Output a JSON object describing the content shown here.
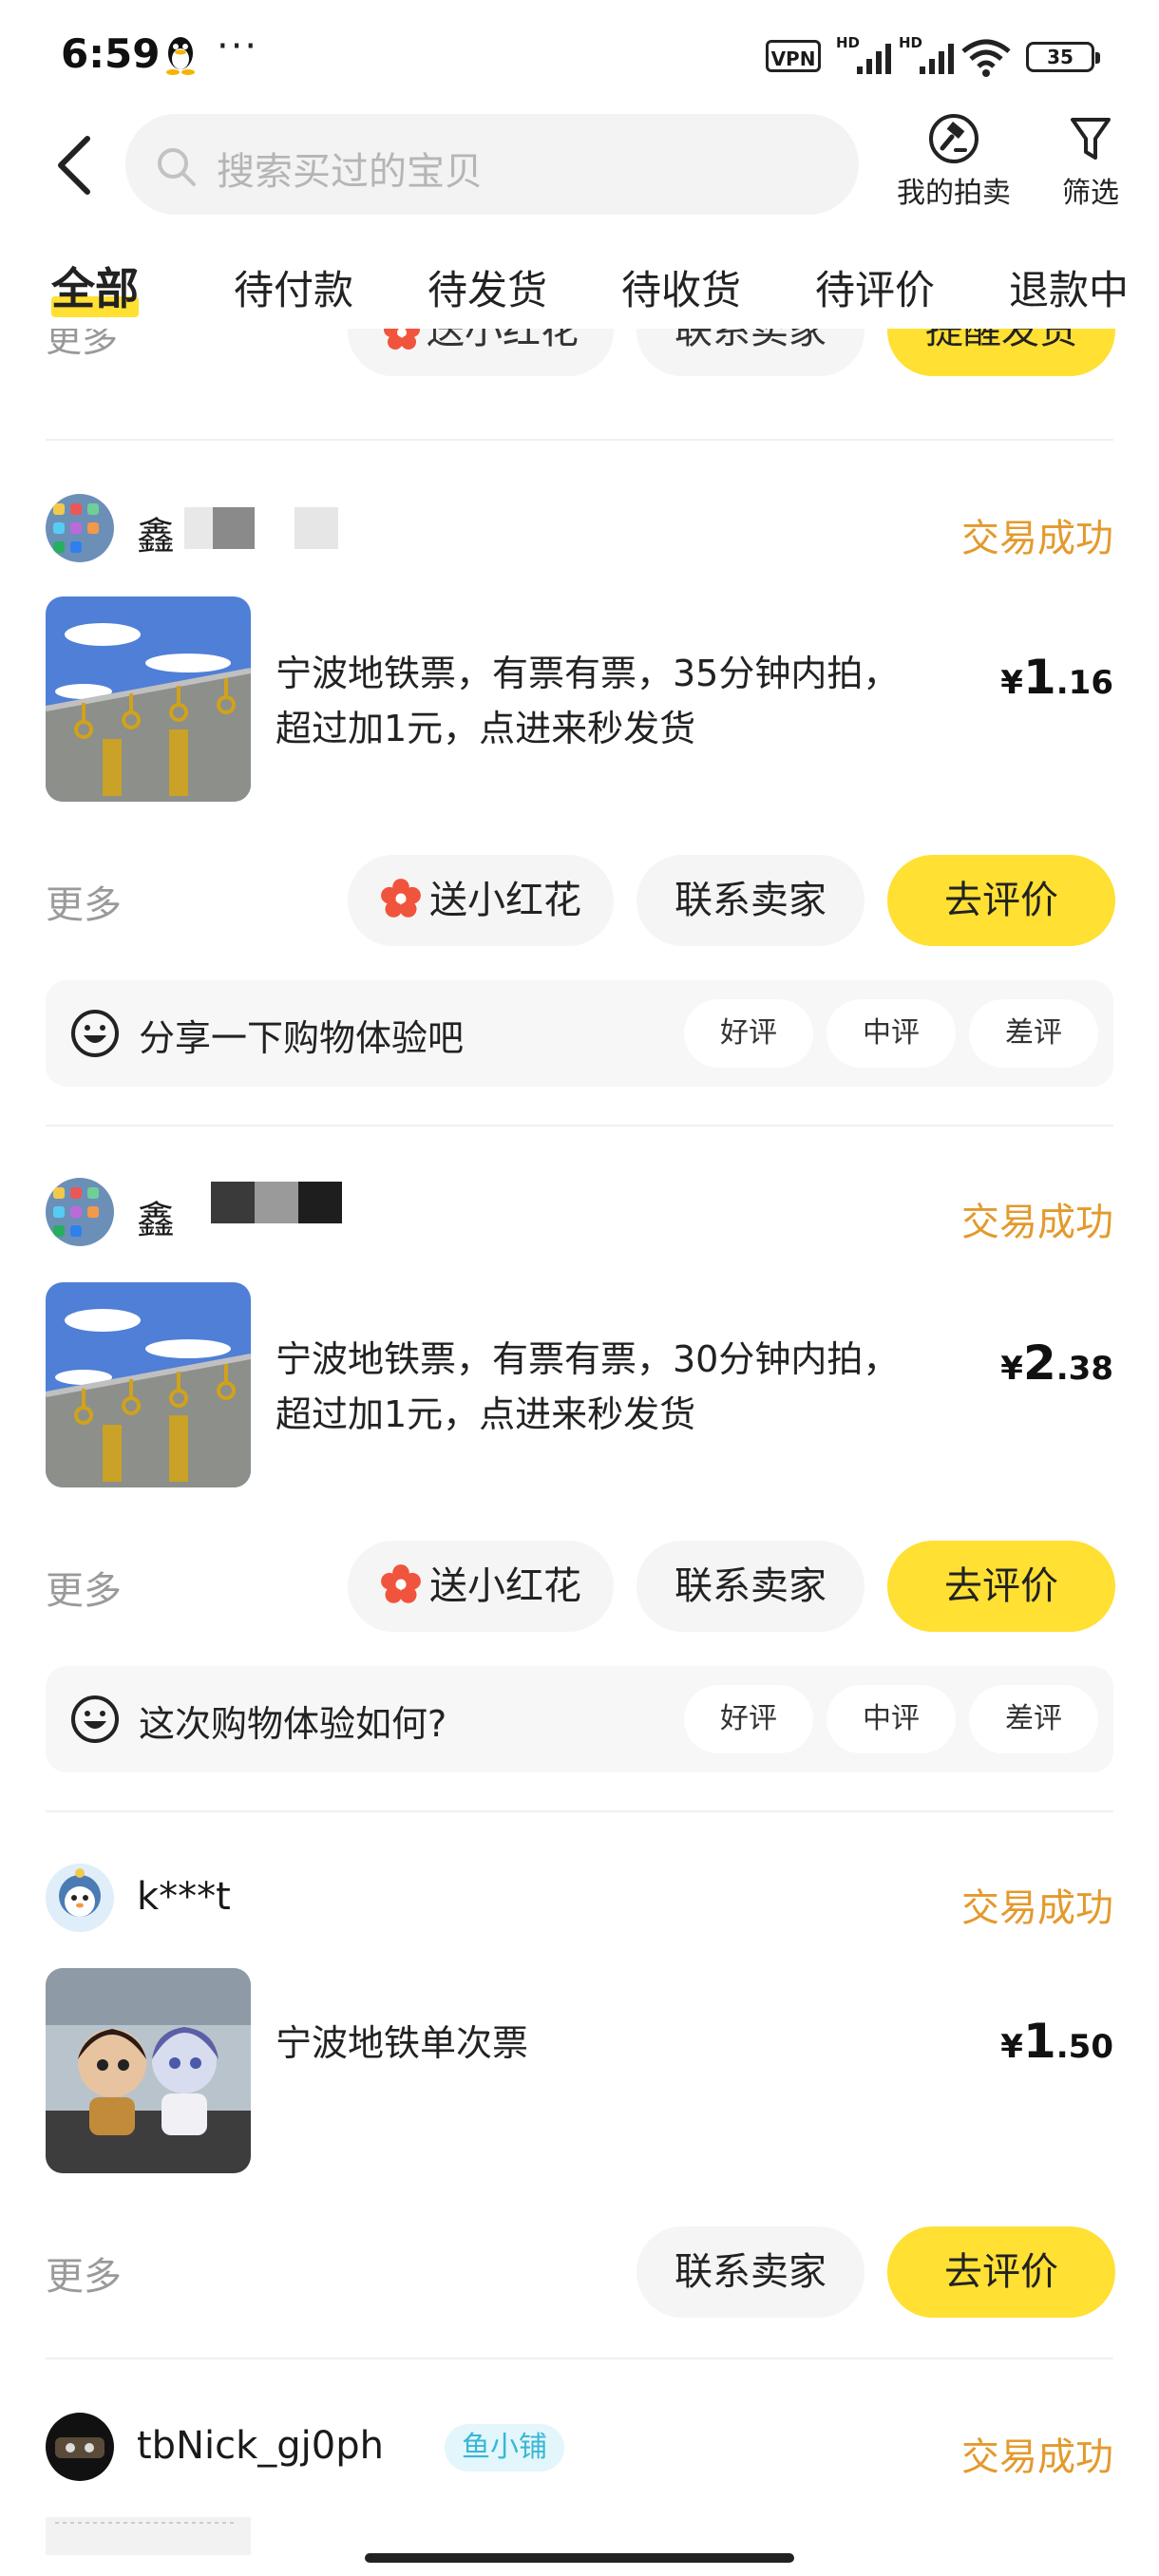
{
  "status_bar": {
    "time": "6:59",
    "dots": "···",
    "vpn": "VPN",
    "hd1": "HD",
    "hd2": "HD",
    "battery": "35"
  },
  "header": {
    "search_placeholder": "搜索买过的宝贝",
    "my_auction": "我的拍卖",
    "filter": "筛选"
  },
  "tabs": [
    "全部",
    "待付款",
    "待发货",
    "待收货",
    "待评价",
    "退款中"
  ],
  "partial_row": {
    "more": "更多",
    "flower": "送小红花",
    "contact": "联系卖家",
    "remind": "提醒发货"
  },
  "orders": [
    {
      "shop": "鑫",
      "status": "交易成功",
      "title_line1": "宁波地铁票，有票有票，35分钟内拍，",
      "title_line2": "超过加1元，点进来秒发货",
      "price_symbol": "¥",
      "price_int": "1",
      "price_dec": ".16",
      "more": "更多",
      "flower": "送小红花",
      "contact": "联系卖家",
      "action": "去评价",
      "review_prompt": "分享一下购物体验吧",
      "review_options": [
        "好评",
        "中评",
        "差评"
      ]
    },
    {
      "shop": "鑫",
      "status": "交易成功",
      "title_line1": "宁波地铁票，有票有票，30分钟内拍，",
      "title_line2": "超过加1元，点进来秒发货",
      "price_symbol": "¥",
      "price_int": "2",
      "price_dec": ".38",
      "more": "更多",
      "flower": "送小红花",
      "contact": "联系卖家",
      "action": "去评价",
      "review_prompt": "这次购物体验如何?",
      "review_options": [
        "好评",
        "中评",
        "差评"
      ]
    },
    {
      "shop": "k***t",
      "status": "交易成功",
      "title_line1": "宁波地铁单次票",
      "price_symbol": "¥",
      "price_int": "1",
      "price_dec": ".50",
      "more": "更多",
      "contact": "联系卖家",
      "action": "去评价"
    },
    {
      "shop": "tbNick_gj0ph",
      "badge": "鱼小铺",
      "status": "交易成功"
    }
  ],
  "colors": {
    "accent": "#ffe033",
    "status": "#e39a2d",
    "flower": "#f0543c"
  }
}
